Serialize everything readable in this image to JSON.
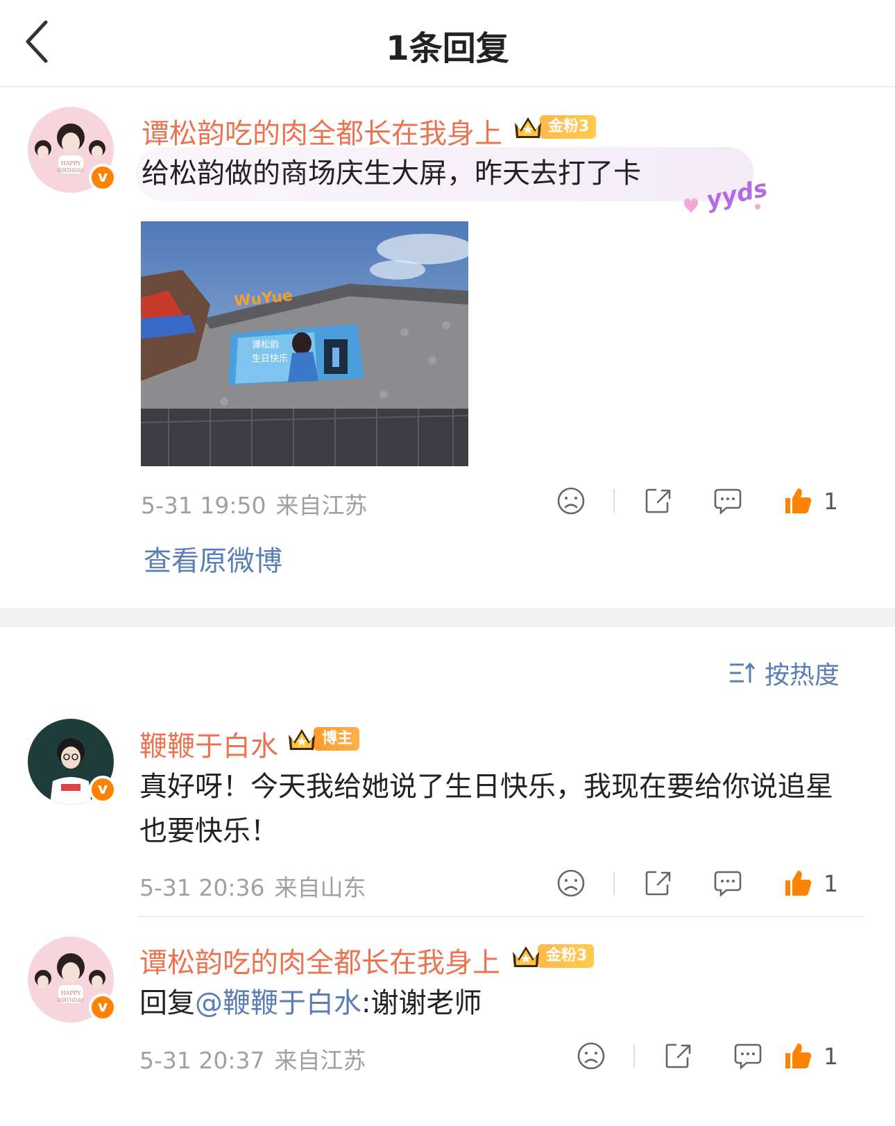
{
  "header": {
    "title": "1条回复"
  },
  "main_post": {
    "username": "谭松韵吃的肉全都长在我身上",
    "badge": "金粉3",
    "text": "给松韵做的商场庆生大屏，昨天去打了卡",
    "sticker": "yyds",
    "time": "5-31 19:50",
    "source": "来自江苏",
    "likes": "1",
    "view_original": "查看原微博"
  },
  "sort": {
    "label": "按热度"
  },
  "replies": [
    {
      "username": "鞭鞭于白水",
      "badge": "博主",
      "text": "真好呀！今天我给她说了生日快乐，我现在要给你说追星也要快乐！",
      "time": "5-31 20:36",
      "source": "来自山东",
      "likes": "1"
    },
    {
      "username": "谭松韵吃的肉全都长在我身上",
      "badge": "金粉3",
      "reply_prefix": "回复",
      "mention": "@鞭鞭于白水",
      "reply_text": ":谢谢老师",
      "time": "5-31 20:37",
      "source": "来自江苏",
      "likes": "1"
    }
  ],
  "avatar_text": {
    "verified": "v",
    "line1": "HAPPY",
    "line2": "BIRTHDAY"
  },
  "photo_text": {
    "mall_name": "WuYue",
    "screen_line1": "谭松韵",
    "screen_line2": "生日快乐"
  },
  "colors": {
    "username": "#eb7350",
    "link": "#5a7db8",
    "like": "#ff8200",
    "meta": "#a0a0a0"
  }
}
